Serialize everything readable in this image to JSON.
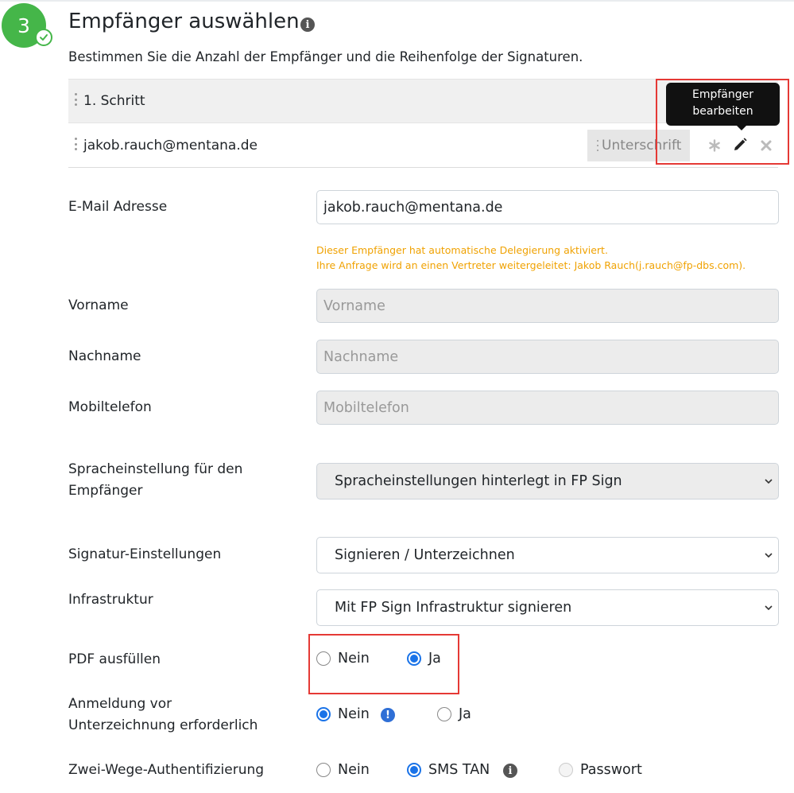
{
  "step": {
    "number": "3",
    "title": "Empfänger auswählen",
    "subtitle": "Bestimmen Sie die Anzahl der Empfänger und die Reihenfolge der Signaturen."
  },
  "workflow": {
    "step_label": "1. Schritt",
    "recipient_email": "jakob.rauch@mentana.de",
    "badge": "Unterschrift",
    "tooltip_line1": "Empfänger",
    "tooltip_line2": "bearbeiten"
  },
  "form": {
    "email_label": "E-Mail Adresse",
    "email_value": "jakob.rauch@mentana.de",
    "warning_line1": "Dieser Empfänger hat automatische Delegierung aktiviert.",
    "warning_line2": "Ihre Anfrage wird an einen Vertreter weitergeleitet: Jakob Rauch(j.rauch@fp-dbs.com).",
    "firstname_label": "Vorname",
    "firstname_placeholder": "Vorname",
    "lastname_label": "Nachname",
    "lastname_placeholder": "Nachname",
    "mobile_label": "Mobiltelefon",
    "mobile_placeholder": "Mobiltelefon",
    "language_label_line1": "Spracheinstellung für den",
    "language_label_line2": "Empfänger",
    "language_value": "Spracheinstellungen hinterlegt in FP Sign",
    "signature_label": "Signatur-Einstellungen",
    "signature_value": "Signieren / Unterzeichnen",
    "infra_label": "Infrastruktur",
    "infra_value": "Mit FP Sign Infrastruktur signieren",
    "pdf_label": "PDF ausfüllen",
    "pdf_options": [
      "Nein",
      "Ja"
    ],
    "pdf_selected": "Ja",
    "login_label_line1": "Anmeldung vor",
    "login_label_line2": "Unterzeichnung erforderlich",
    "login_options": [
      "Nein",
      "Ja"
    ],
    "login_selected": "Nein",
    "twofa_label": "Zwei-Wege-Authentifizierung",
    "twofa_options": [
      "Nein",
      "SMS TAN",
      "Passwort"
    ],
    "twofa_selected": "SMS TAN"
  },
  "colors": {
    "step_green": "#45b649",
    "warning_orange": "#f0a202",
    "radio_blue": "#1a73e8",
    "highlight_red": "#e53935"
  }
}
